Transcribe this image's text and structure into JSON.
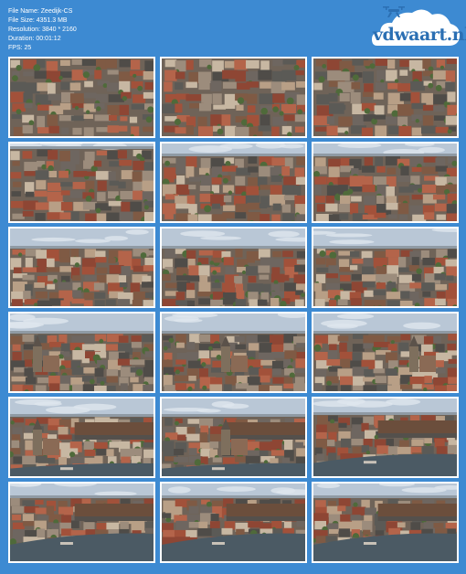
{
  "file_info": {
    "name_line": "File Name: Zeedijk-CS",
    "size_line": "File Size: 4351.3 MB",
    "resolution_line": "Resolution: 3840 * 2160",
    "duration_line": "Duration: 00:01:12",
    "fps_line": "FPS: 25"
  },
  "logo": {
    "text": "vdwaart.nl",
    "icon": "drone-cloud-logo"
  },
  "colors": {
    "background": "#3d8ad2",
    "thumb_border": "#ffffff",
    "logo_text": "#2b6fb3"
  },
  "thumbnails": [
    {
      "scene": "rooftops-topdown"
    },
    {
      "scene": "rooftops-topdown"
    },
    {
      "scene": "rooftops-topdown"
    },
    {
      "scene": "rooftops-oblique"
    },
    {
      "scene": "city-horizon"
    },
    {
      "scene": "city-horizon"
    },
    {
      "scene": "city-skyline"
    },
    {
      "scene": "city-skyline"
    },
    {
      "scene": "city-skyline"
    },
    {
      "scene": "church-skyline"
    },
    {
      "scene": "church-skyline"
    },
    {
      "scene": "church-skyline"
    },
    {
      "scene": "church-station"
    },
    {
      "scene": "church-station"
    },
    {
      "scene": "station-water"
    },
    {
      "scene": "station-waterfront"
    },
    {
      "scene": "station-waterfront"
    },
    {
      "scene": "station-waterfront"
    }
  ]
}
